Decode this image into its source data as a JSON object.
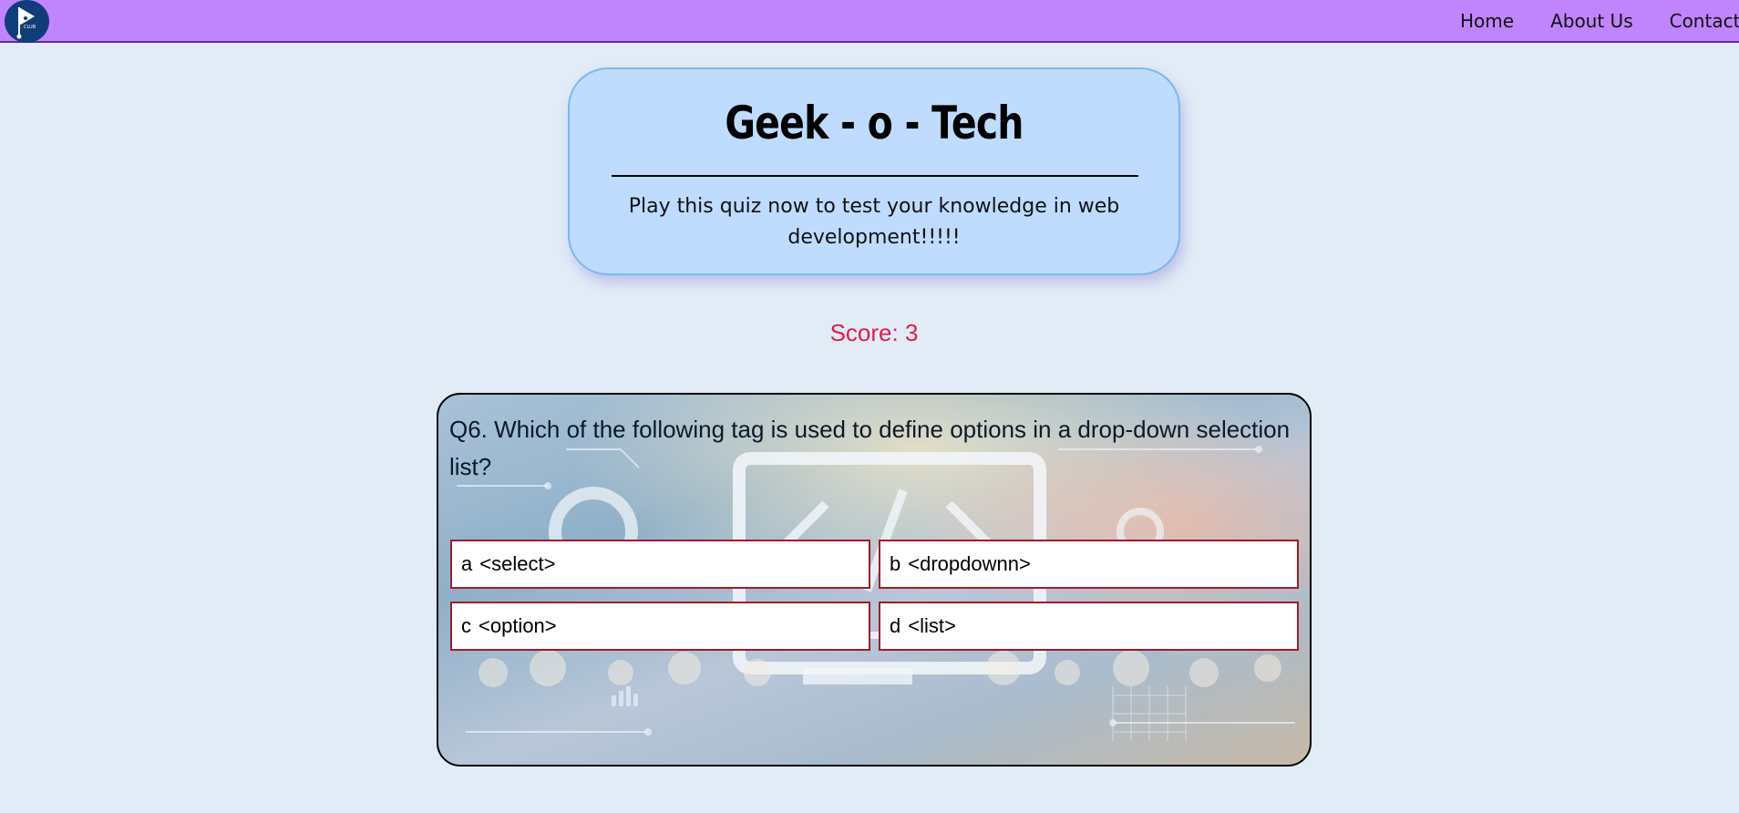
{
  "navbar": {
    "logo_text": "CLUB",
    "links": [
      "Home",
      "About Us",
      "Contact"
    ]
  },
  "header": {
    "title": "Geek - o - Tech",
    "subtitle": "Play this quiz now to test your knowledge in web development!!!!!"
  },
  "score": {
    "label": "Score: 3"
  },
  "quiz": {
    "question": "Q6. Which of the following tag is used to define options in a drop-down selection list?",
    "options": [
      {
        "letter": "a",
        "text": "<select>"
      },
      {
        "letter": "b",
        "text": "<dropdownn>"
      },
      {
        "letter": "c",
        "text": "<option>"
      },
      {
        "letter": "d",
        "text": "<list>"
      }
    ]
  },
  "colors": {
    "navbar_bg": "#c084fc",
    "page_bg": "#e1ecf7",
    "card_bg": "#bfdbfe",
    "score_color": "#e11d48",
    "option_border": "#9f1d2b"
  }
}
